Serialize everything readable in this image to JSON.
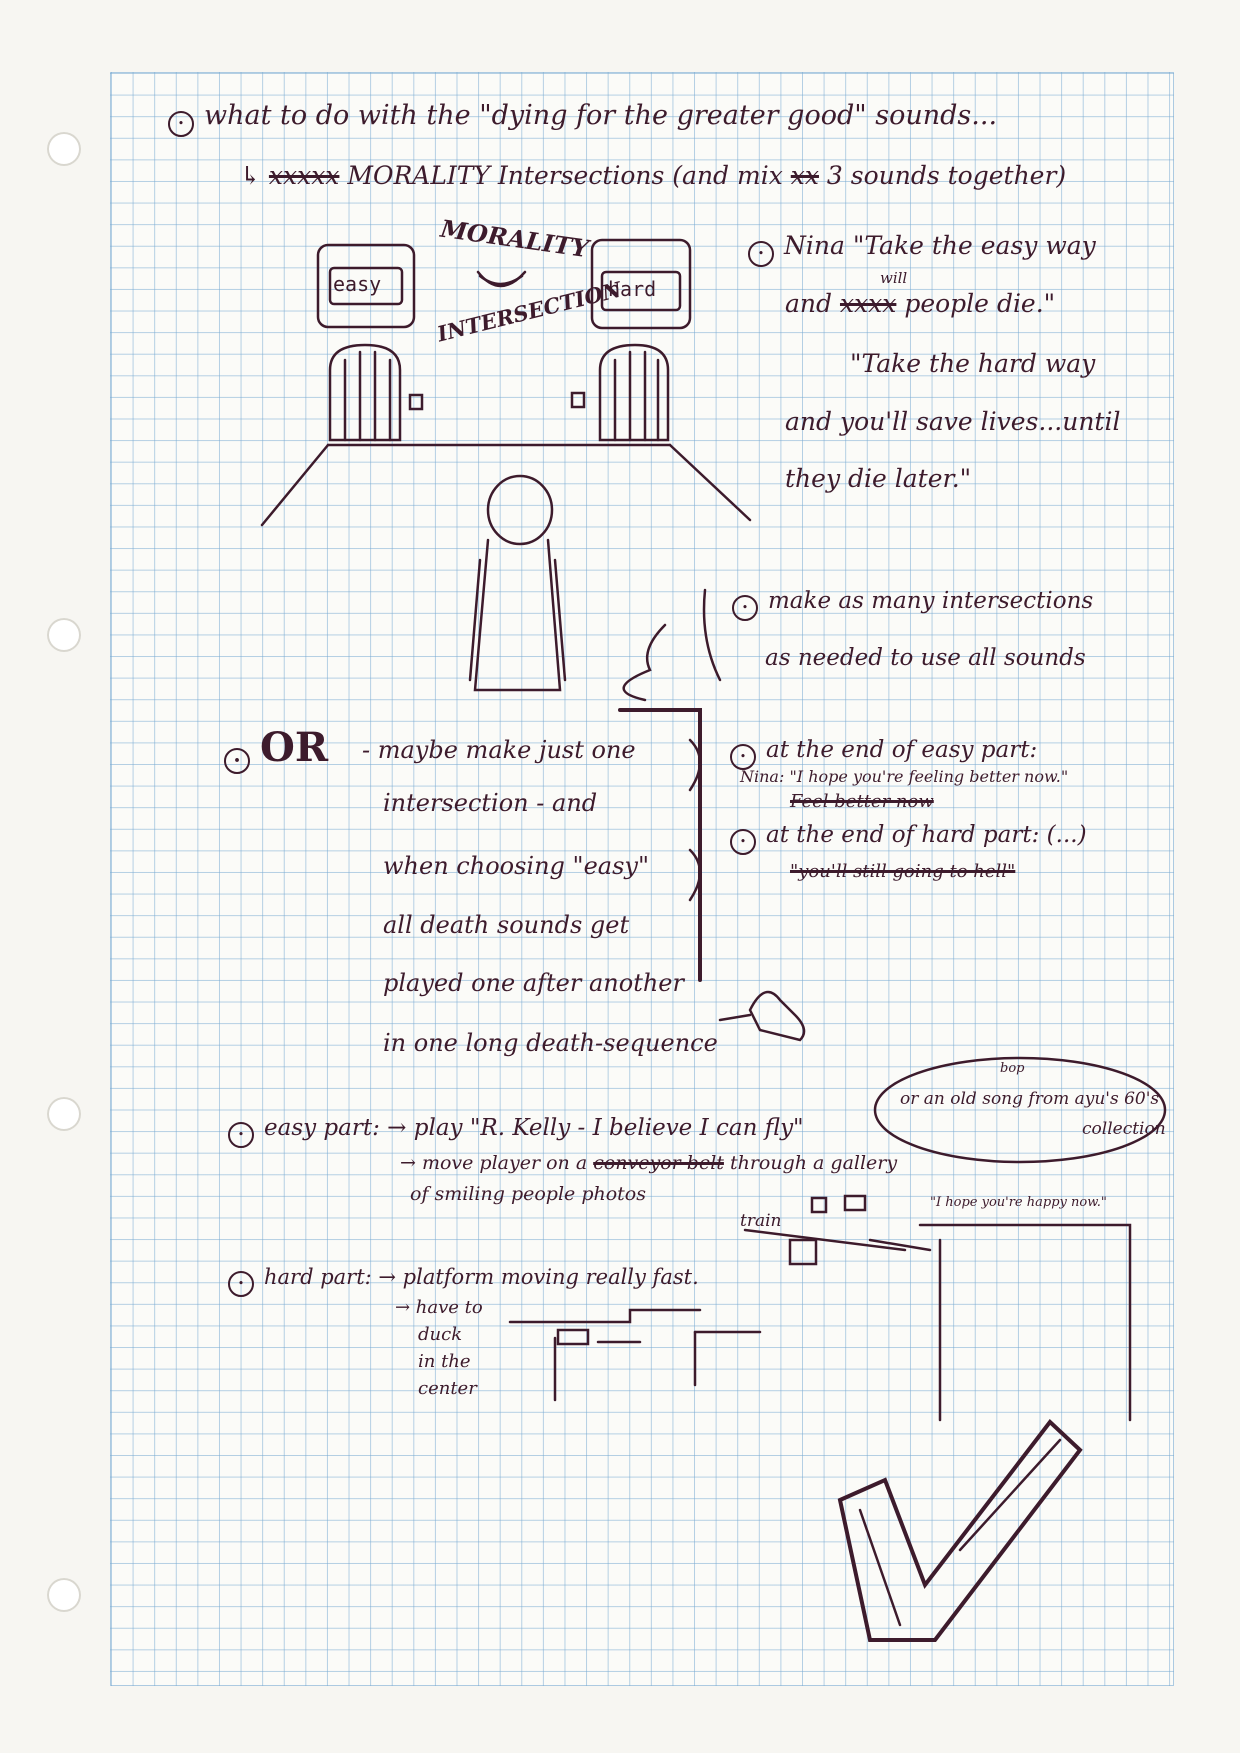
{
  "notes": {
    "line1": "what to do with the \"dying for the greater good\" sounds...",
    "line2_strike": "xxxxx",
    "line2": "MORALITY Intersections (and mix",
    "line2_strike2": "xx",
    "line2_end": "3 sounds together)",
    "sketch_title_top": "MORALITY",
    "sketch_title_bottom": "INTERSECTION",
    "door_easy": "easy",
    "door_hard": "hard",
    "nina_1": "Nina \"Take the easy way",
    "nina_2a": "and",
    "nina_2b": "xxxx",
    "nina_2c": "people",
    "nina_2_will": "will",
    "nina_2d": "die.\"",
    "nina_3": "\"Take the hard way",
    "nina_4": "and you'll save lives...until",
    "nina_5": "they die later.\"",
    "many_1": "make as many intersections",
    "many_2": "as needed to use all sounds",
    "or_label": "OR",
    "or_1": "- maybe make just one",
    "or_2": "intersection - and",
    "or_3": "when choosing \"easy\"",
    "or_4": "all death sounds get",
    "or_5": "played one after another",
    "or_6": "in one long death-sequence",
    "end_easy": "at the end of easy part:",
    "end_easy_nina": "Nina: \"I hope you're feeling better now.\"",
    "end_easy_strike": "Feel better now",
    "end_hard": "at the end of hard part: (...)",
    "end_hard_strike": "\"you'll still going to hell\"",
    "easy_part": "easy part: → play \"R. Kelly - I believe I can fly\"",
    "easy_alt_1": "or an old",
    "easy_alt_bop": "bop",
    "easy_alt_2": "song from ayu's 60's",
    "easy_alt_3": "collection",
    "easy_move": "→ move player on a",
    "easy_move_strike": "conveyor belt",
    "easy_through": "through a gallery",
    "easy_photos": "of smiling people photos",
    "train": "train",
    "hope_happy": "\"I hope you're happy now.\"",
    "hard_part": "hard part: → platform moving really fast.",
    "hard_2": "→ have to",
    "hard_3": "duck",
    "hard_4": "in the",
    "hard_5": "center"
  },
  "colors": {
    "ink": "#3d1b2c",
    "grid": "#78aad2",
    "paper": "#fbfbf8"
  }
}
